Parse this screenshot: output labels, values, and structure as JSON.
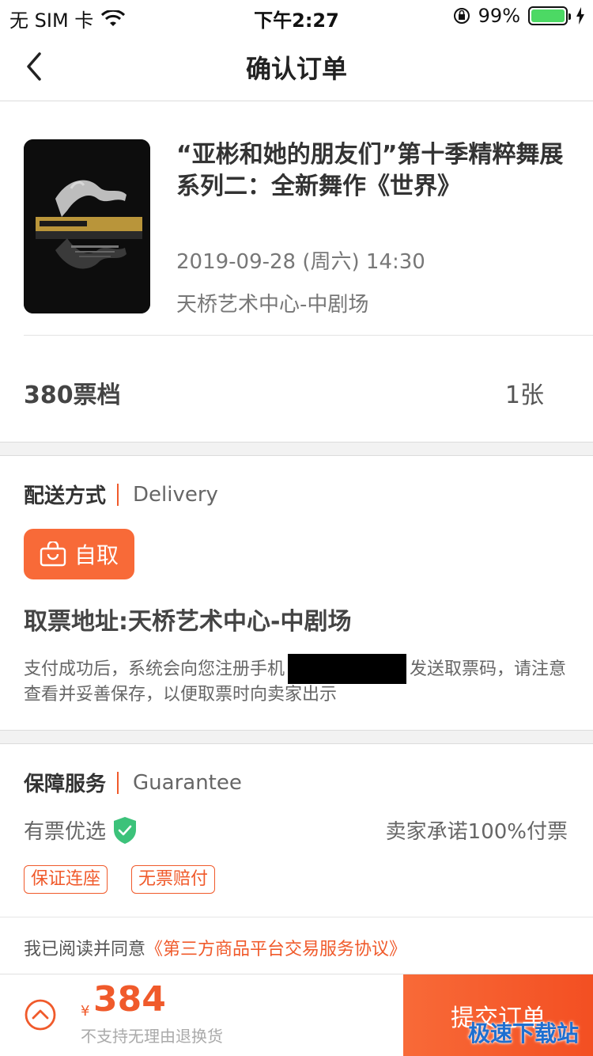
{
  "status_bar": {
    "carrier": "无 SIM 卡",
    "time": "下午2:27",
    "battery": "99%",
    "battery_level": 0.99
  },
  "nav": {
    "title": "确认订单"
  },
  "show": {
    "title": "“亚彬和她的朋友们”第十季精粹舞展 系列二：全新舞作《世界》",
    "date": "2019-09-28 (周六) 14:30",
    "venue": "天桥艺术中心-中剧场"
  },
  "ticket": {
    "name": "380票档",
    "quantity": "1张"
  },
  "delivery": {
    "label_cn": "配送方式",
    "label_en": "Delivery",
    "method": "自取",
    "address": "取票地址:天桥艺术中心-中剧场",
    "note_before": "支付成功后，系统会向您注册手机",
    "note_after": "发送取票码，请注意查看并妥善保存，以便取票时向卖家出示"
  },
  "guarantee": {
    "label_cn": "保障服务",
    "label_en": "Guarantee",
    "left_text": "有票优选",
    "right_text": "卖家承诺100%付票",
    "tags": [
      "保证连座",
      "无票赔付"
    ]
  },
  "agreement": {
    "prefix": "我已阅读并同意",
    "link": "《第三方商品平台交易服务协议》"
  },
  "footer": {
    "currency": "¥",
    "price": "384",
    "note": "不支持无理由退换货",
    "submit": "提交订单",
    "watermark": "极速下载站"
  },
  "colors": {
    "accent": "#f05a2b",
    "button": "#f86a38",
    "shield": "#3cc27a"
  }
}
